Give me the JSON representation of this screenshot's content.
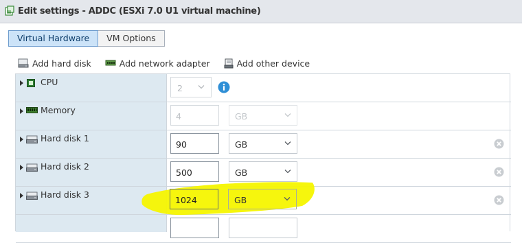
{
  "window": {
    "title": "Edit settings - ADDC (ESXi 7.0 U1 virtual machine)"
  },
  "tabs": [
    {
      "label": "Virtual Hardware",
      "active": true
    },
    {
      "label": "VM Options",
      "active": false
    }
  ],
  "toolbar": {
    "add_hard_disk": "Add hard disk",
    "add_network_adapter": "Add network adapter",
    "add_other_device": "Add other device"
  },
  "hardware": {
    "cpu": {
      "label": "CPU",
      "value": "2"
    },
    "memory": {
      "label": "Memory",
      "value": "4",
      "unit": "GB"
    },
    "disk1": {
      "label": "Hard disk 1",
      "value": "90",
      "unit": "GB"
    },
    "disk2": {
      "label": "Hard disk 2",
      "value": "500",
      "unit": "GB"
    },
    "disk3": {
      "label": "Hard disk 3",
      "value": "1024",
      "unit": "GB"
    }
  },
  "colors": {
    "active_tab": "#cce3f8",
    "left_panel": "#dde9f1",
    "info_icon": "#2f8fd6",
    "highlight": "#f5f500"
  },
  "icons": [
    "vm-settings-icon",
    "hard-disk-icon",
    "network-adapter-icon",
    "other-device-icon",
    "cpu-icon",
    "memory-icon",
    "info-icon",
    "remove-icon",
    "chevron-down-icon",
    "expand-arrow-icon"
  ]
}
